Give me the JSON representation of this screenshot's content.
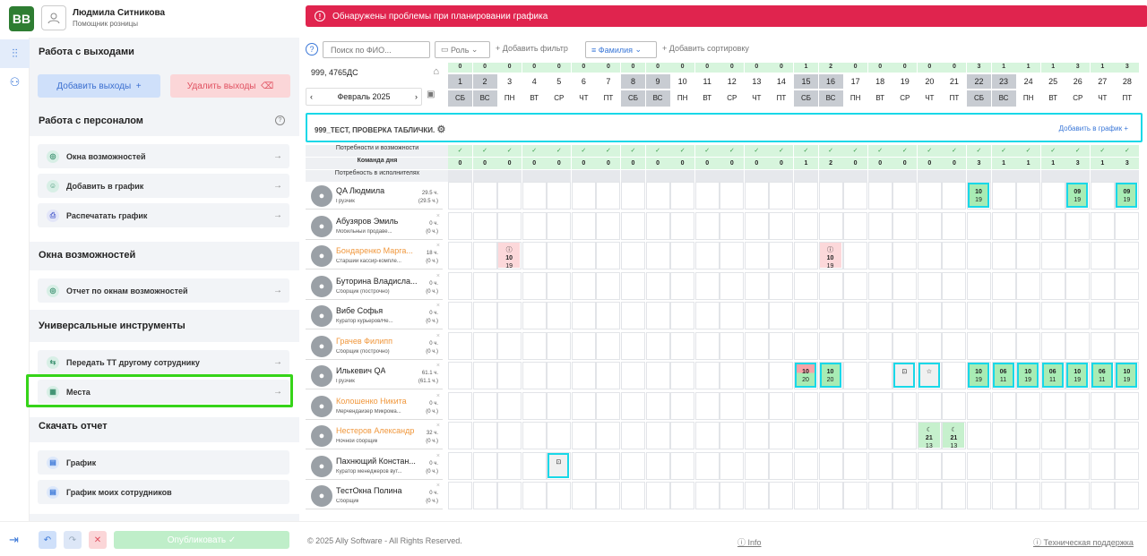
{
  "app": {
    "logo": "BB",
    "user_name": "Людмила Ситникова",
    "user_role": "Помощник розницы"
  },
  "alert": {
    "text": "Обнаружены проблемы при планировании графика"
  },
  "sidebar": {
    "sections": [
      {
        "title": "Работа с выходами",
        "buttons": [
          {
            "label": "Добавить выходы",
            "icon": "+"
          },
          {
            "label": "Удалить выходы",
            "icon": "⌫"
          }
        ]
      },
      {
        "title": "Работа с персоналом",
        "items": [
          "Окна возможностей",
          "Добавить в график",
          "Распечатать график"
        ]
      },
      {
        "title": "Окна возможностей",
        "items": [
          "Отчет по окнам возможностей"
        ]
      },
      {
        "title": "Универсальные инструменты",
        "items": [
          "Передать ТТ другому сотруднику",
          "Места"
        ]
      },
      {
        "title": "Скачать отчет",
        "items": [
          "График",
          "График моих сотрудников"
        ]
      }
    ]
  },
  "bottom": {
    "publish_label": "Опубликовать",
    "copyright": "© 2025 Ally Software - All Rights Reserved.",
    "info": "Info",
    "support": "Техническая поддержка"
  },
  "toolbar": {
    "search_placeholder": "Поиск по ФИО...",
    "role_label": "Роль",
    "add_filter": "Добавить фильтр",
    "sort_label": "Фамилия",
    "add_sort": "Добавить сортировку"
  },
  "store": {
    "name": "999, 4765ДС",
    "month": "Февраль 2025"
  },
  "days": [
    {
      "n": "1",
      "d": "СБ",
      "c": "0",
      "we": true
    },
    {
      "n": "2",
      "d": "ВС",
      "c": "0",
      "we": true
    },
    {
      "n": "3",
      "d": "ПН",
      "c": "0"
    },
    {
      "n": "4",
      "d": "ВТ",
      "c": "0"
    },
    {
      "n": "5",
      "d": "СР",
      "c": "0"
    },
    {
      "n": "6",
      "d": "ЧТ",
      "c": "0"
    },
    {
      "n": "7",
      "d": "ПТ",
      "c": "0"
    },
    {
      "n": "8",
      "d": "СБ",
      "c": "0",
      "we": true
    },
    {
      "n": "9",
      "d": "ВС",
      "c": "0",
      "we": true
    },
    {
      "n": "10",
      "d": "ПН",
      "c": "0"
    },
    {
      "n": "11",
      "d": "ВТ",
      "c": "0"
    },
    {
      "n": "12",
      "d": "СР",
      "c": "0"
    },
    {
      "n": "13",
      "d": "ЧТ",
      "c": "0"
    },
    {
      "n": "14",
      "d": "ПТ",
      "c": "0"
    },
    {
      "n": "15",
      "d": "СБ",
      "c": "1",
      "we": true
    },
    {
      "n": "16",
      "d": "ВС",
      "c": "2",
      "we": true
    },
    {
      "n": "17",
      "d": "ПН",
      "c": "0"
    },
    {
      "n": "18",
      "d": "ВТ",
      "c": "0"
    },
    {
      "n": "19",
      "d": "СР",
      "c": "0"
    },
    {
      "n": "20",
      "d": "ЧТ",
      "c": "0"
    },
    {
      "n": "21",
      "d": "ПТ",
      "c": "0"
    },
    {
      "n": "22",
      "d": "СБ",
      "c": "3",
      "we": true
    },
    {
      "n": "23",
      "d": "ВС",
      "c": "1",
      "we": true
    },
    {
      "n": "24",
      "d": "ПН",
      "c": "1"
    },
    {
      "n": "25",
      "d": "ВТ",
      "c": "1"
    },
    {
      "n": "26",
      "d": "СР",
      "c": "3"
    },
    {
      "n": "27",
      "d": "ЧТ",
      "c": "1"
    },
    {
      "n": "28",
      "d": "ПТ",
      "c": "3"
    }
  ],
  "team": {
    "name": "999_ТЕСТ, ПРОВЕРКА ТАБЛИЧКИ.",
    "add_label": "Добавить в график"
  },
  "requirements": {
    "row1": "Потребности и возможности",
    "row2": "Команда дня",
    "row3": "Потребность в исполнителях"
  },
  "employees": [
    {
      "name": "QA Людмила",
      "pos": "Грузчик",
      "h1": "29.5 ч.",
      "h2": "(29.5 ч.)",
      "orange": false
    },
    {
      "name": "Абузяров Эмиль",
      "pos": "Мобильный продаве...",
      "h1": "0 ч.",
      "h2": "(0 ч.)",
      "orange": false
    },
    {
      "name": "Бондаренко Марга...",
      "pos": "Старший кассир-компле...",
      "h1": "18 ч.",
      "h2": "(0 ч.)",
      "orange": true
    },
    {
      "name": "Буторина Владисла...",
      "pos": "Сборщик (построчно)",
      "h1": "0 ч.",
      "h2": "(0 ч.)",
      "orange": false
    },
    {
      "name": "Вибе Софья",
      "pos": "Куратор курьеров/Не...",
      "h1": "0 ч.",
      "h2": "(0 ч.)",
      "orange": false
    },
    {
      "name": "Грачев Филипп",
      "pos": "Сборщик (построчно)",
      "h1": "0 ч.",
      "h2": "(0 ч.)",
      "orange": true
    },
    {
      "name": "Илькевич QA",
      "pos": "Грузчик",
      "h1": "61.1 ч.",
      "h2": "(61.1 ч.)",
      "orange": false
    },
    {
      "name": "Колошенко Никита",
      "pos": "Мерчендайзер Микрома...",
      "h1": "0 ч.",
      "h2": "(0 ч.)",
      "orange": true
    },
    {
      "name": "Нестеров Александр",
      "pos": "Ночной сборщик",
      "h1": "32 ч.",
      "h2": "(0 ч.)",
      "orange": true
    },
    {
      "name": "Пахнющий Констан...",
      "pos": "Куратор менеджеров вут...",
      "h1": "0 ч.",
      "h2": "(0 ч.)",
      "orange": false
    },
    {
      "name": "ТестОкна Полина",
      "pos": "Сборщик",
      "h1": "0 ч.",
      "h2": "(0 ч.)",
      "orange": false
    }
  ],
  "shifts": [
    {
      "row": 0,
      "day": 21,
      "t": "10",
      "b": "19",
      "k": "green"
    },
    {
      "row": 0,
      "day": 25,
      "t": "09",
      "b": "19",
      "k": "green"
    },
    {
      "row": 0,
      "day": 27,
      "t": "09",
      "b": "19",
      "k": "green"
    },
    {
      "row": 2,
      "day": 2,
      "t": "10",
      "b": "19",
      "k": "pink",
      "i": "ⓘ"
    },
    {
      "row": 2,
      "day": 15,
      "t": "10",
      "b": "19",
      "k": "pink",
      "i": "ⓘ"
    },
    {
      "row": 6,
      "day": 14,
      "t": "10",
      "b": "20",
      "k": "mixed"
    },
    {
      "row": 6,
      "day": 15,
      "t": "10",
      "b": "20",
      "k": "green"
    },
    {
      "row": 6,
      "day": 18,
      "t": "",
      "b": "",
      "k": "gray",
      "i": "⊡"
    },
    {
      "row": 6,
      "day": 19,
      "t": "",
      "b": "",
      "k": "gray",
      "i": "☆"
    },
    {
      "row": 6,
      "day": 21,
      "t": "10",
      "b": "19",
      "k": "green"
    },
    {
      "row": 6,
      "day": 22,
      "t": "06",
      "b": "11",
      "k": "green"
    },
    {
      "row": 6,
      "day": 23,
      "t": "10",
      "b": "19",
      "k": "green"
    },
    {
      "row": 6,
      "day": 24,
      "t": "06",
      "b": "11",
      "k": "green"
    },
    {
      "row": 6,
      "day": 25,
      "t": "10",
      "b": "19",
      "k": "green"
    },
    {
      "row": 6,
      "day": 26,
      "t": "06",
      "b": "11",
      "k": "green"
    },
    {
      "row": 6,
      "day": 27,
      "t": "10",
      "b": "19",
      "k": "green"
    },
    {
      "row": 8,
      "day": 19,
      "t": "21",
      "b": "13",
      "k": "lgreen",
      "i": "☾"
    },
    {
      "row": 8,
      "day": 20,
      "t": "21",
      "b": "13",
      "k": "lgreen",
      "i": "☾"
    },
    {
      "row": 9,
      "day": 4,
      "t": "",
      "b": "",
      "k": "gray",
      "i": "⊡"
    }
  ],
  "colors": {
    "accent": "#3b78d8",
    "alert": "#e0244e",
    "highlight": "#36d419",
    "shift_border": "#19d8e8"
  }
}
